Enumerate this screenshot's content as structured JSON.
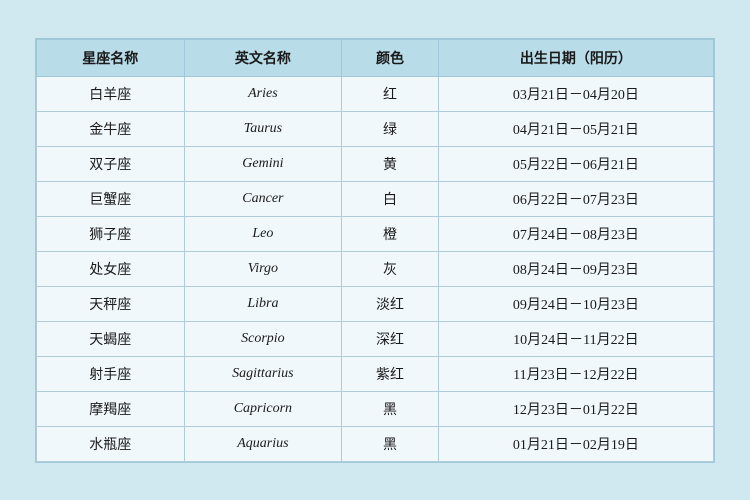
{
  "table": {
    "headers": [
      {
        "id": "col-chinese-name",
        "label": "星座名称"
      },
      {
        "id": "col-english-name",
        "label": "英文名称"
      },
      {
        "id": "col-color",
        "label": "颜色"
      },
      {
        "id": "col-birthdate",
        "label": "出生日期（阳历）"
      }
    ],
    "rows": [
      {
        "chinese": "白羊座",
        "english": "Aries",
        "color": "红",
        "dates": "03月21日－04月20日"
      },
      {
        "chinese": "金牛座",
        "english": "Taurus",
        "color": "绿",
        "dates": "04月21日－05月21日"
      },
      {
        "chinese": "双子座",
        "english": "Gemini",
        "color": "黄",
        "dates": "05月22日－06月21日"
      },
      {
        "chinese": "巨蟹座",
        "english": "Cancer",
        "color": "白",
        "dates": "06月22日－07月23日"
      },
      {
        "chinese": "狮子座",
        "english": "Leo",
        "color": "橙",
        "dates": "07月24日－08月23日"
      },
      {
        "chinese": "处女座",
        "english": "Virgo",
        "color": "灰",
        "dates": "08月24日－09月23日"
      },
      {
        "chinese": "天秤座",
        "english": "Libra",
        "color": "淡红",
        "dates": "09月24日－10月23日"
      },
      {
        "chinese": "天蝎座",
        "english": "Scorpio",
        "color": "深红",
        "dates": "10月24日－11月22日"
      },
      {
        "chinese": "射手座",
        "english": "Sagittarius",
        "color": "紫红",
        "dates": "11月23日－12月22日"
      },
      {
        "chinese": "摩羯座",
        "english": "Capricorn",
        "color": "黑",
        "dates": "12月23日－01月22日"
      },
      {
        "chinese": "水瓶座",
        "english": "Aquarius",
        "color": "黑",
        "dates": "01月21日－02月19日"
      }
    ]
  }
}
